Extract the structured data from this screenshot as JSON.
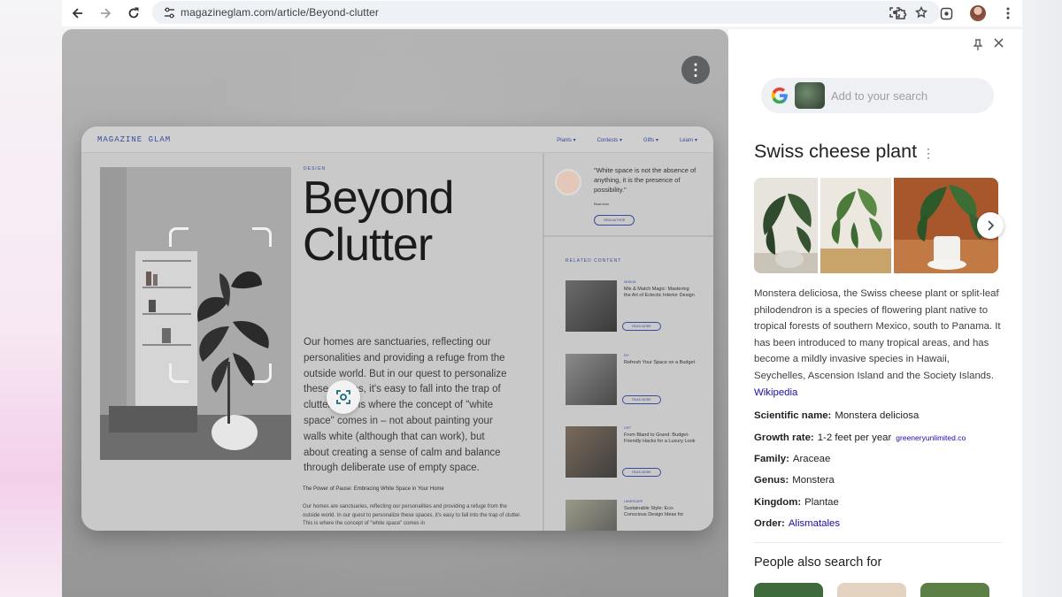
{
  "browser": {
    "url": "magazineglam.com/article/Beyond-clutter",
    "toolbar_icons": [
      "arrow-left-icon",
      "arrow-right-icon",
      "reload-icon",
      "tune-icon",
      "lens-icon",
      "star-icon",
      "extensions-icon",
      "screenshot-icon",
      "profile-avatar",
      "more-vert-icon"
    ]
  },
  "article": {
    "brand": "MAGAZINE GLAM",
    "nav_links": [
      "Plants ▾",
      "Contests ▾",
      "Gifts ▾",
      "Learn ▾"
    ],
    "kicker": "DESIGN",
    "headline_line1": "Beyond",
    "headline_line2": "Clutter",
    "body": "Our homes are sanctuaries, reflecting our personalities and providing a refuge from the outside world. But in our quest to personalize these spaces, it's easy to fall into the trap of clutter. This is where the concept of \"white space\" comes in – not about painting your walls white (although that can work), but about creating a sense of calm and balance through deliberate use of empty space.",
    "subhead": "The Power of Pause: Embracing White Space in Your Home",
    "small_body": "Our homes are sanctuaries, reflecting our personalities and providing a refuge from the outside world. In our quest to personalize these spaces, it's easy to fall into the trap of clutter. This is where the concept of \"white space\" comes in",
    "quote": "\"White space is not the absence of anything, it is the presence of possibility.\"",
    "quote_author": "Read more",
    "quote_button": "VIEW AUTHOR",
    "related_label": "RELATED CONTENT",
    "related": [
      {
        "tag": "DESIGN",
        "title": "Mix & Match Magic: Mastering the Art of Eclectic Interior Design",
        "button": "READ MORE"
      },
      {
        "tag": "DIY",
        "title": "Refresh Your Space on a Budget",
        "button": "READ MORE"
      },
      {
        "tag": "GIFT",
        "title": "From Bland to Grand: Budget-Friendly Hacks for a Luxury Look",
        "button": "READ MORE"
      },
      {
        "tag": "LANDSCAPE",
        "title": "Sustainable Style: Eco-Conscious Design Ideas for",
        "button": "READ MORE"
      }
    ]
  },
  "panel": {
    "search_placeholder": "Add to your search",
    "title": "Swiss cheese plant",
    "title_menu": "⋮",
    "description": "Monstera deliciosa, the Swiss cheese plant or split-leaf philodendron is a species of flowering plant native to tropical forests of southern Mexico, south to Panama. It has been introduced to many tropical areas, and has become a mildly invasive species in Hawaii, Seychelles, Ascension Island and the Society Islands.",
    "description_link": "Wikipedia",
    "facts": [
      {
        "label": "Scientific name:",
        "value": "Monstera deliciosa",
        "link": ""
      },
      {
        "label": "Growth rate:",
        "value": "1-2 feet per year",
        "link": "greeneryunlimited.co"
      },
      {
        "label": "Family:",
        "value": "Araceae",
        "link": ""
      },
      {
        "label": "Genus:",
        "value": "Monstera",
        "link": ""
      },
      {
        "label": "Kingdom:",
        "value": "Plantae",
        "link": ""
      },
      {
        "label": "Order:",
        "value": "",
        "link": "Alismatales"
      }
    ],
    "people_also_search": "People also search for",
    "colors": {
      "accent": "#3a4a9a",
      "link": "#1a0dab",
      "panel_bg": "#ffffff"
    }
  }
}
